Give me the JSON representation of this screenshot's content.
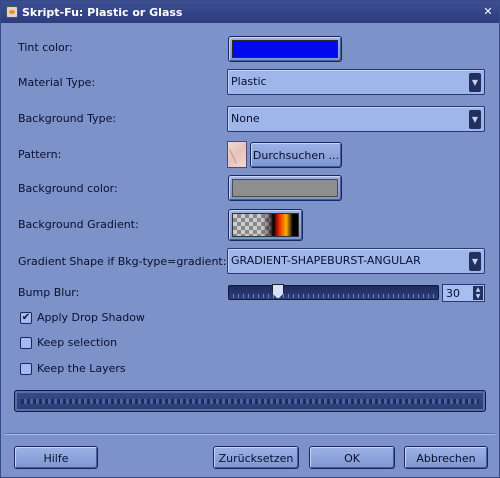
{
  "window": {
    "title": "Skript-Fu: Plastic or Glass",
    "close_icon": "close-icon"
  },
  "fields": {
    "tint_color": {
      "label": "Tint color:",
      "color": "#0008f0"
    },
    "material_type": {
      "label": "Material Type:",
      "value": "Plastic"
    },
    "background_type": {
      "label": "Background Type:",
      "value": "None"
    },
    "pattern": {
      "label": "Pattern:",
      "browse_button": "Durchsuchen ..."
    },
    "background_color": {
      "label": "Background color:",
      "color": "#8e8e8e"
    },
    "background_gradient": {
      "label": "Background Gradient:"
    },
    "gradient_shape": {
      "label": "Gradient Shape if Bkg-type=gradient:",
      "value": "GRADIENT-SHAPEBURST-ANGULAR"
    },
    "bump_blur": {
      "label": "Bump Blur:",
      "value": "30",
      "slider_fraction": 0.23
    }
  },
  "checkboxes": [
    {
      "label": "Apply Drop Shadow",
      "checked": true
    },
    {
      "label": "Keep selection",
      "checked": false
    },
    {
      "label": "Keep the Layers",
      "checked": false
    }
  ],
  "buttons": {
    "help": "Hilfe",
    "reset": "Zurücksetzen",
    "ok": "OK",
    "cancel": "Abbrechen"
  }
}
